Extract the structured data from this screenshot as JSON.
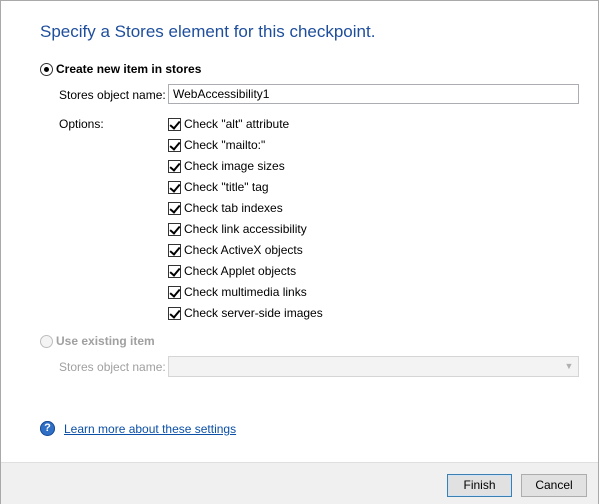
{
  "title": "Specify a Stores element for this checkpoint.",
  "create_new": {
    "label": "Create new item in stores",
    "object_name_label": "Stores object name:",
    "object_name_value": "WebAccessibility1",
    "options_label": "Options:",
    "options": [
      {
        "label": "Check \"alt\" attribute",
        "checked": true
      },
      {
        "label": "Check \"mailto:\"",
        "checked": true
      },
      {
        "label": "Check image sizes",
        "checked": true
      },
      {
        "label": "Check \"title\" tag",
        "checked": true
      },
      {
        "label": "Check tab indexes",
        "checked": true
      },
      {
        "label": "Check link accessibility",
        "checked": true
      },
      {
        "label": "Check ActiveX objects",
        "checked": true
      },
      {
        "label": "Check Applet objects",
        "checked": true
      },
      {
        "label": "Check multimedia links",
        "checked": true
      },
      {
        "label": "Check server-side images",
        "checked": true
      }
    ]
  },
  "use_existing": {
    "label": "Use existing item",
    "object_name_label": "Stores object name:",
    "object_name_value": ""
  },
  "help": {
    "icon": "?",
    "link_text": "Learn more about these settings"
  },
  "buttons": {
    "finish": "Finish",
    "cancel": "Cancel"
  },
  "colors": {
    "title": "#1e4e9c",
    "link": "#0b4fa6"
  }
}
